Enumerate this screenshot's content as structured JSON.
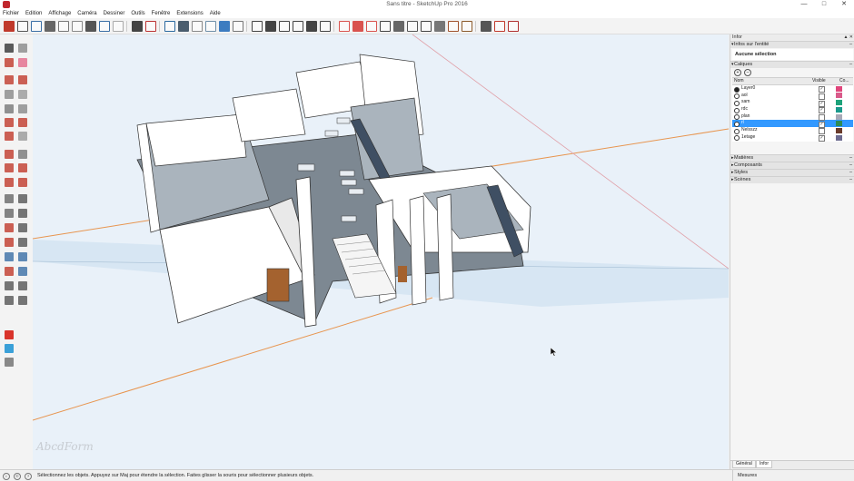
{
  "window": {
    "title": "Sans titre - SketchUp Pro 2016"
  },
  "menu": [
    "Fichier",
    "Edition",
    "Affichage",
    "Caméra",
    "Dessiner",
    "Outils",
    "Fenêtre",
    "Extensions",
    "Aide"
  ],
  "toolbar_icons": [
    "new-icon",
    "open-icon",
    "save-icon",
    "cut-icon",
    "copy-icon",
    "paste-icon",
    "erase-icon",
    "undo-icon",
    "redo-icon",
    "print-icon",
    "model-info-icon",
    "xray-icon",
    "wireframe-icon",
    "hidden-line-icon",
    "shaded-icon",
    "shaded-textures-icon",
    "monochrome-icon",
    "iso-view-icon",
    "top-view-icon",
    "front-view-icon",
    "right-view-icon",
    "back-view-icon",
    "left-view-icon",
    "section-plane-icon",
    "display-section-icon",
    "section-cuts-icon",
    "dimension-icon",
    "protractor-icon",
    "text-icon",
    "axes-icon",
    "3d-text-icon",
    "stairs-icon",
    "fence-icon",
    "extension-icon",
    "warehouse-icon",
    "extension-warehouse-icon"
  ],
  "panel": {
    "title": "Infor",
    "entity_section": "Infos sur l'entité",
    "entity_value": "Aucune sélection",
    "layers_section": "Calques",
    "col_name": "Nom",
    "col_visible": "Visible",
    "col_color": "Co...",
    "layers": [
      {
        "name": "Layer0",
        "active": true,
        "visible": true,
        "color": "#e0457b"
      },
      {
        "name": "aol",
        "active": false,
        "visible": false,
        "color": "#d95a8a"
      },
      {
        "name": "sam",
        "active": false,
        "visible": true,
        "color": "#1ea27a"
      },
      {
        "name": "rdc",
        "active": false,
        "visible": true,
        "color": "#1a9a8c"
      },
      {
        "name": "plan",
        "active": false,
        "visible": false,
        "color": "#a7a9b7"
      },
      {
        "name": "rl",
        "active": false,
        "visible": true,
        "color": "#2e8b57",
        "selected": true
      },
      {
        "name": "Nelsszz",
        "active": false,
        "visible": false,
        "color": "#6a3b2b"
      },
      {
        "name": "1etage",
        "active": false,
        "visible": true,
        "color": "#6d6b8f"
      }
    ],
    "collapsed_sections": [
      "Matières",
      "Composants",
      "Styles",
      "Scènes"
    ],
    "tabs": [
      "Général",
      "Infor"
    ]
  },
  "viewport": {
    "watermark": "AbcdForm"
  },
  "status": {
    "message": "Sélectionnez les objets. Appuyez sur Maj pour étendre la sélection. Faites glisser la souris pour sélectionner plusieurs objets.",
    "measures_label": "Mesures"
  }
}
